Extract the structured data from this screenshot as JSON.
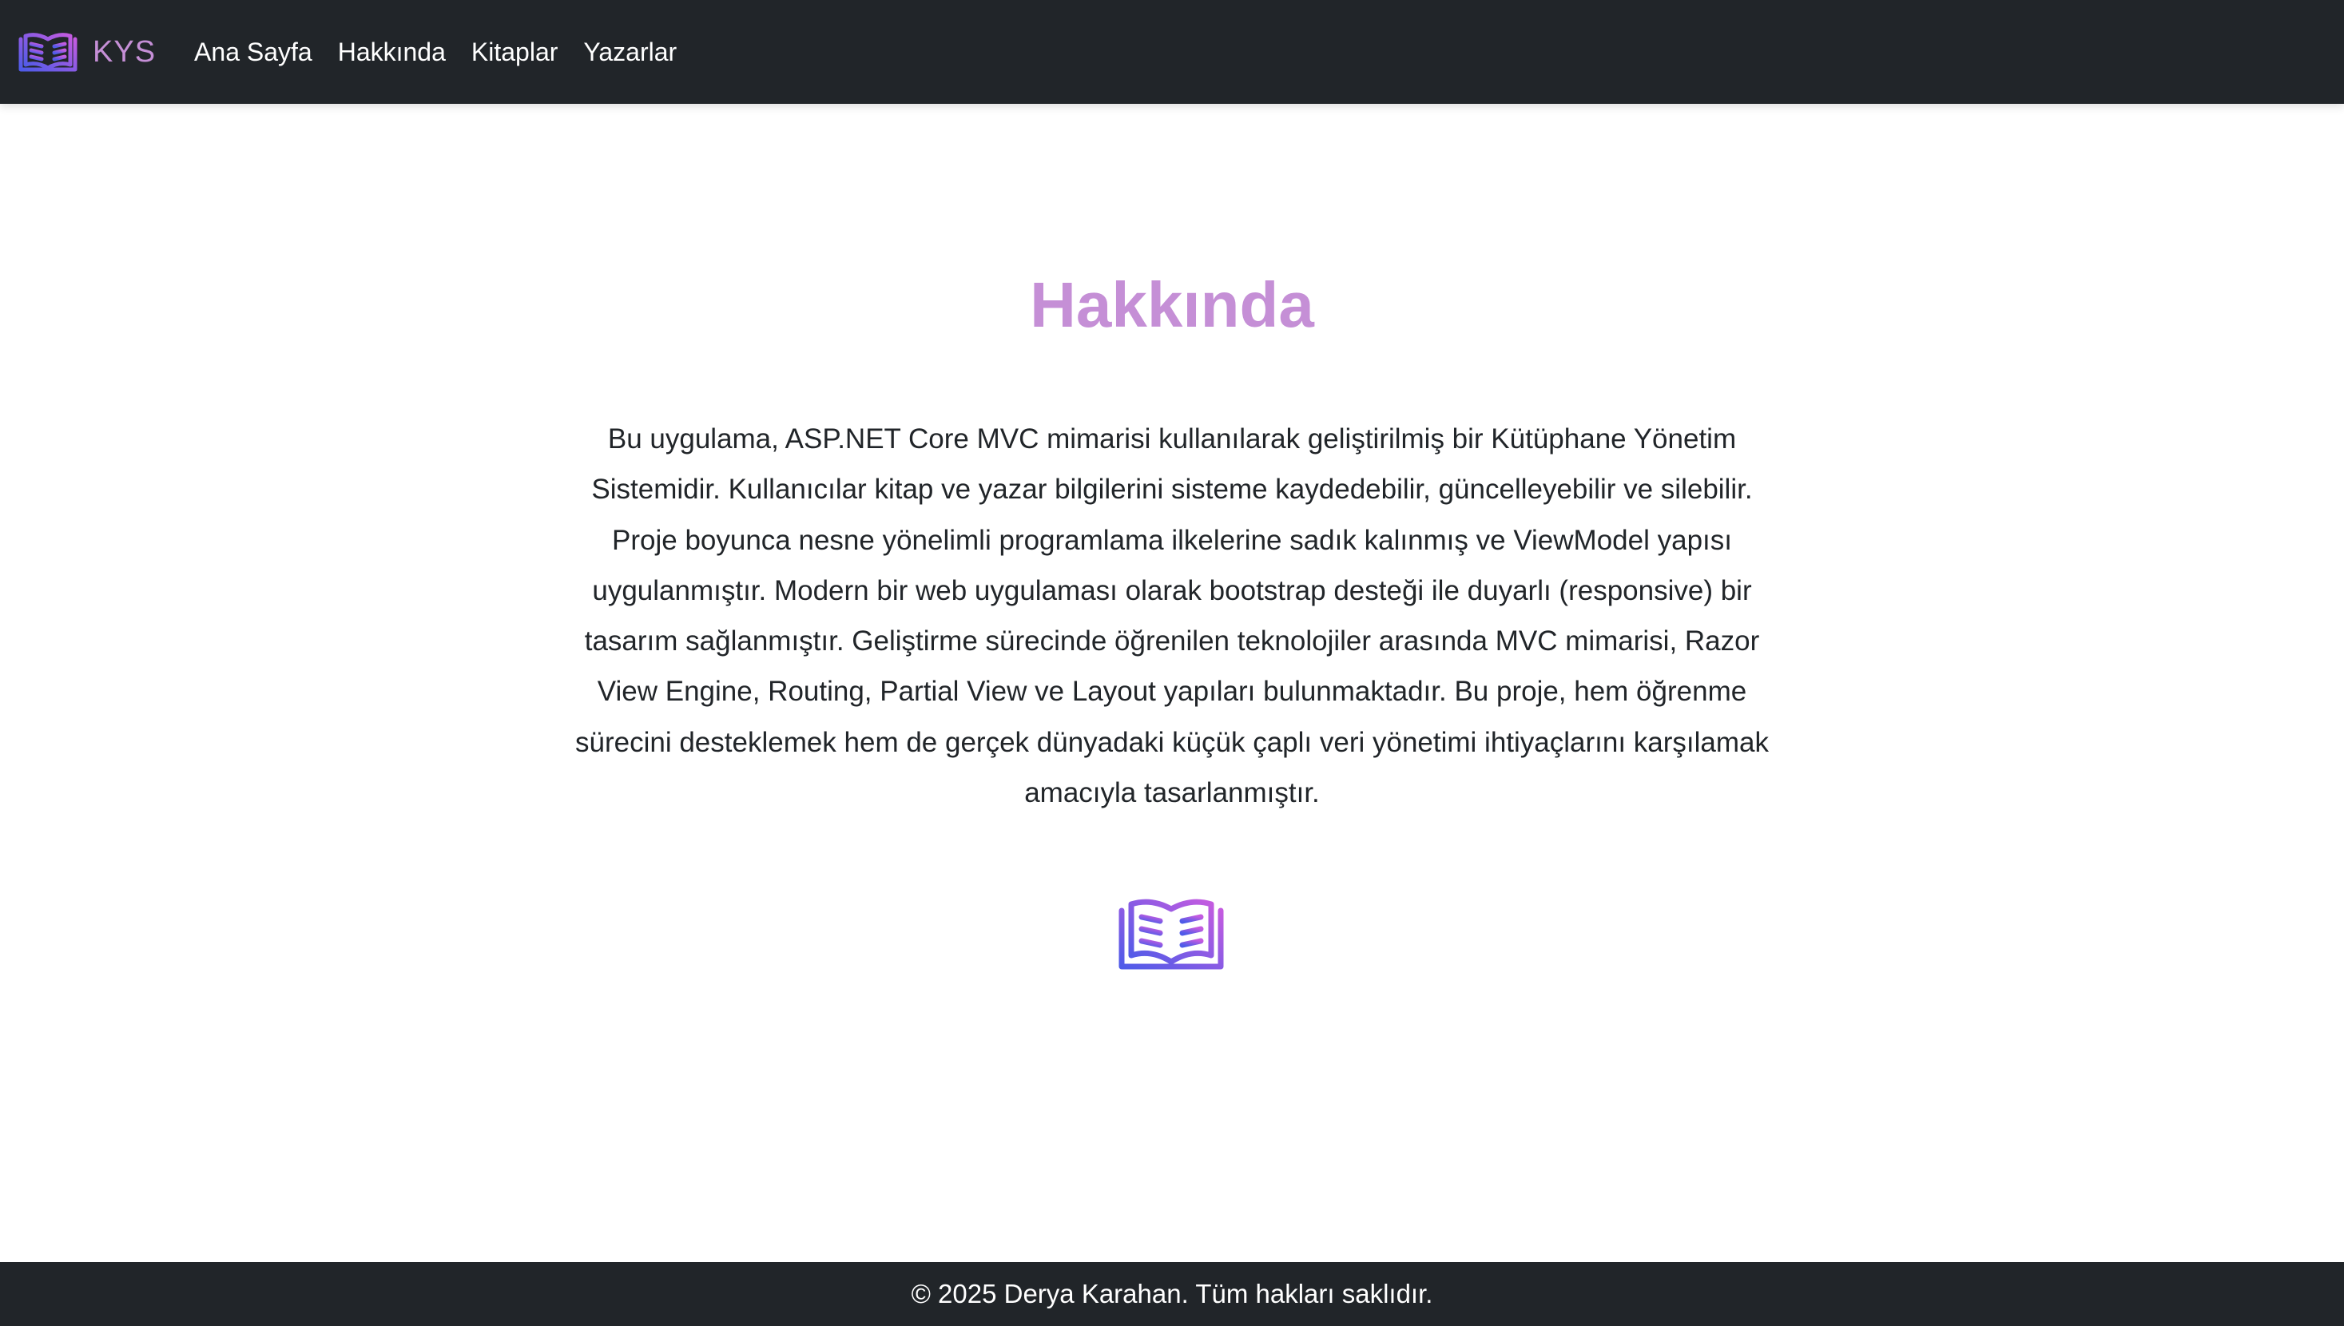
{
  "navbar": {
    "brand_text": "KYS",
    "brand_icon": "open-book-icon",
    "links": [
      {
        "label": "Ana Sayfa"
      },
      {
        "label": "Hakkında"
      },
      {
        "label": "Kitaplar"
      },
      {
        "label": "Yazarlar"
      }
    ]
  },
  "main": {
    "title": "Hakkında",
    "paragraph": "Bu uygulama, ASP.NET Core MVC mimarisi kullanılarak geliştirilmiş bir Kütüphane Yönetim Sistemidir. Kullanıcılar kitap ve yazar bilgilerini sisteme kaydedebilir, güncelleyebilir ve silebilir. Proje boyunca nesne yönelimli programlama ilkelerine sadık kalınmış ve ViewModel yapısı uygulanmıştır. Modern bir web uygulaması olarak bootstrap desteği ile duyarlı (responsive) bir tasarım sağlanmıştır. Geliştirme sürecinde öğrenilen teknolojiler arasında MVC mimarisi, Razor View Engine, Routing, Partial View ve Layout yapıları bulunmaktadır. Bu proje, hem öğrenme sürecini desteklemek hem de gerçek dünyadaki küçük çaplı veri yönetimi ihtiyaçlarını karşılamak amacıyla tasarlanmıştır.",
    "illustration_icon": "open-book-icon"
  },
  "footer": {
    "text": "© 2025 Derya Karahan. Tüm hakları saklıdır."
  },
  "colors": {
    "navbar_bg": "#212529",
    "accent": "#c58fd6",
    "icon_gradient_start": "#4f5be8",
    "icon_gradient_end": "#c45be0",
    "text": "#212529"
  }
}
